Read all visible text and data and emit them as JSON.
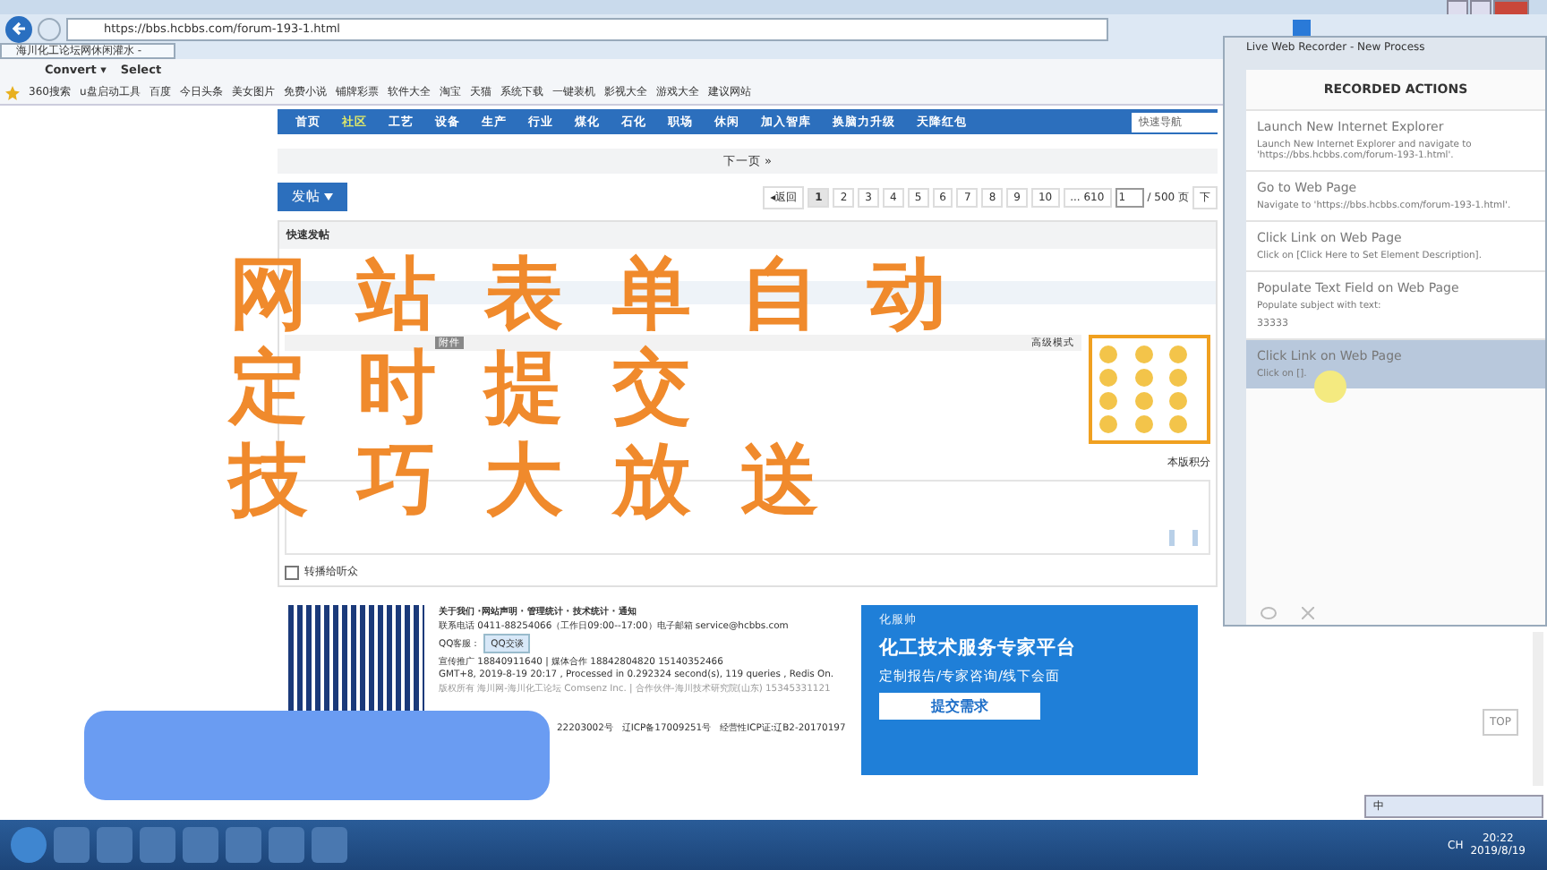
{
  "browser": {
    "url": "https://bbs.hcbbs.com/forum-193-1.html",
    "tab": "海川化工论坛网休闲灌水 -",
    "toolbar": [
      "Convert ▾",
      "Select"
    ],
    "favorites": [
      "360搜索",
      "u盘启动工具",
      "百度",
      "今日头条",
      "美女图片",
      "免费小说",
      "铺牌彩票",
      "软件大全",
      "淘宝",
      "天猫",
      "系统下载",
      "一键装机",
      "影视大全",
      "游戏大全",
      "建议网站"
    ]
  },
  "nav": {
    "items": [
      {
        "label": "首页",
        "selected": false
      },
      {
        "label": "社区",
        "selected": true
      },
      {
        "label": "工艺",
        "selected": false
      },
      {
        "label": "设备",
        "selected": false
      },
      {
        "label": "生产",
        "selected": false
      },
      {
        "label": "行业",
        "selected": false
      },
      {
        "label": "煤化",
        "selected": false
      },
      {
        "label": "石化",
        "selected": false
      },
      {
        "label": "职场",
        "selected": false
      },
      {
        "label": "休闲",
        "selected": false
      },
      {
        "label": "加入智库",
        "selected": false
      },
      {
        "label": "换脑力升级",
        "selected": false
      },
      {
        "label": "天降红包",
        "selected": false
      }
    ],
    "quick_nav": "快速导航"
  },
  "next_page": "下一页 »",
  "post_button": "发帖",
  "pagination": {
    "back": "◂返回",
    "pages": [
      {
        "label": "1",
        "selected": true
      },
      {
        "label": "2",
        "selected": false
      },
      {
        "label": "3",
        "selected": false
      },
      {
        "label": "4",
        "selected": false
      },
      {
        "label": "5",
        "selected": false
      },
      {
        "label": "6",
        "selected": false
      },
      {
        "label": "7",
        "selected": false
      },
      {
        "label": "8",
        "selected": false
      },
      {
        "label": "9",
        "selected": false
      },
      {
        "label": "10",
        "selected": false
      },
      {
        "label": "... 610",
        "selected": false
      }
    ],
    "page_input": "1",
    "total": "/ 500 页",
    "next": "下"
  },
  "quick_post": {
    "title": "快速发帖",
    "attach": "附件",
    "advanced": "高级模式",
    "score": "本版积分",
    "forward": "转播给听众",
    "forward_checked": false
  },
  "footer": {
    "links": "关于我们 ·网站声明 · 管理统计 · 技术统计 · 通知",
    "phone": "联系电话 0411-88254066（工作日09:00--17:00）电子邮箱 service@hcbbs.com",
    "qq_label": "QQ客服：",
    "qq_button": "QQ交谈",
    "promo": "宣传推广 18840911640 | 媒体合作 18842804820    15140352466",
    "gmt": "GMT+8, 2019-8-19 20:17 , Processed in 0.292324 second(s), 119 queries , Redis On.",
    "copyright": "版权所有 海川网-海川化工论坛 Comsenz Inc. | 合作伙伴-海川技术研究院(山东) 15345331121",
    "icp": [
      "22203002号",
      "辽ICP备17009251号",
      "经营性ICP证:辽B2-20170197"
    ]
  },
  "ad": {
    "brand": "化服帅",
    "title": "化工技术服务专家平台",
    "subtitle": "定制报告/专家咨询/线下会面",
    "button": "提交需求"
  },
  "top_button": "TOP",
  "overlay_lines": [
    "网 站 表 单 自 动",
    "定 时 提 交",
    "技 巧 大 放 送"
  ],
  "recorder": {
    "title": "Live Web Recorder - New Process",
    "heading": "RECORDED ACTIONS",
    "actions": [
      {
        "title": "Launch New Internet Explorer",
        "detail": "Launch New Internet Explorer and navigate to 'https://bbs.hcbbs.com/forum-193-1.html'.",
        "selected": false
      },
      {
        "title": "Go to Web Page",
        "detail": "Navigate to 'https://bbs.hcbbs.com/forum-193-1.html'.",
        "selected": false
      },
      {
        "title": "Click Link on Web Page",
        "detail": "Click on [Click Here to Set Element Description].",
        "selected": false
      },
      {
        "title": "Populate Text Field on Web Page",
        "detail": "Populate subject with text:",
        "value": "33333",
        "selected": false
      },
      {
        "title": "Click Link on Web Page",
        "detail": "Click on [].",
        "selected": true
      }
    ]
  },
  "taskbar": {
    "lang": "CH",
    "ime": "中",
    "time": "20:22",
    "date": "2019/8/19"
  }
}
